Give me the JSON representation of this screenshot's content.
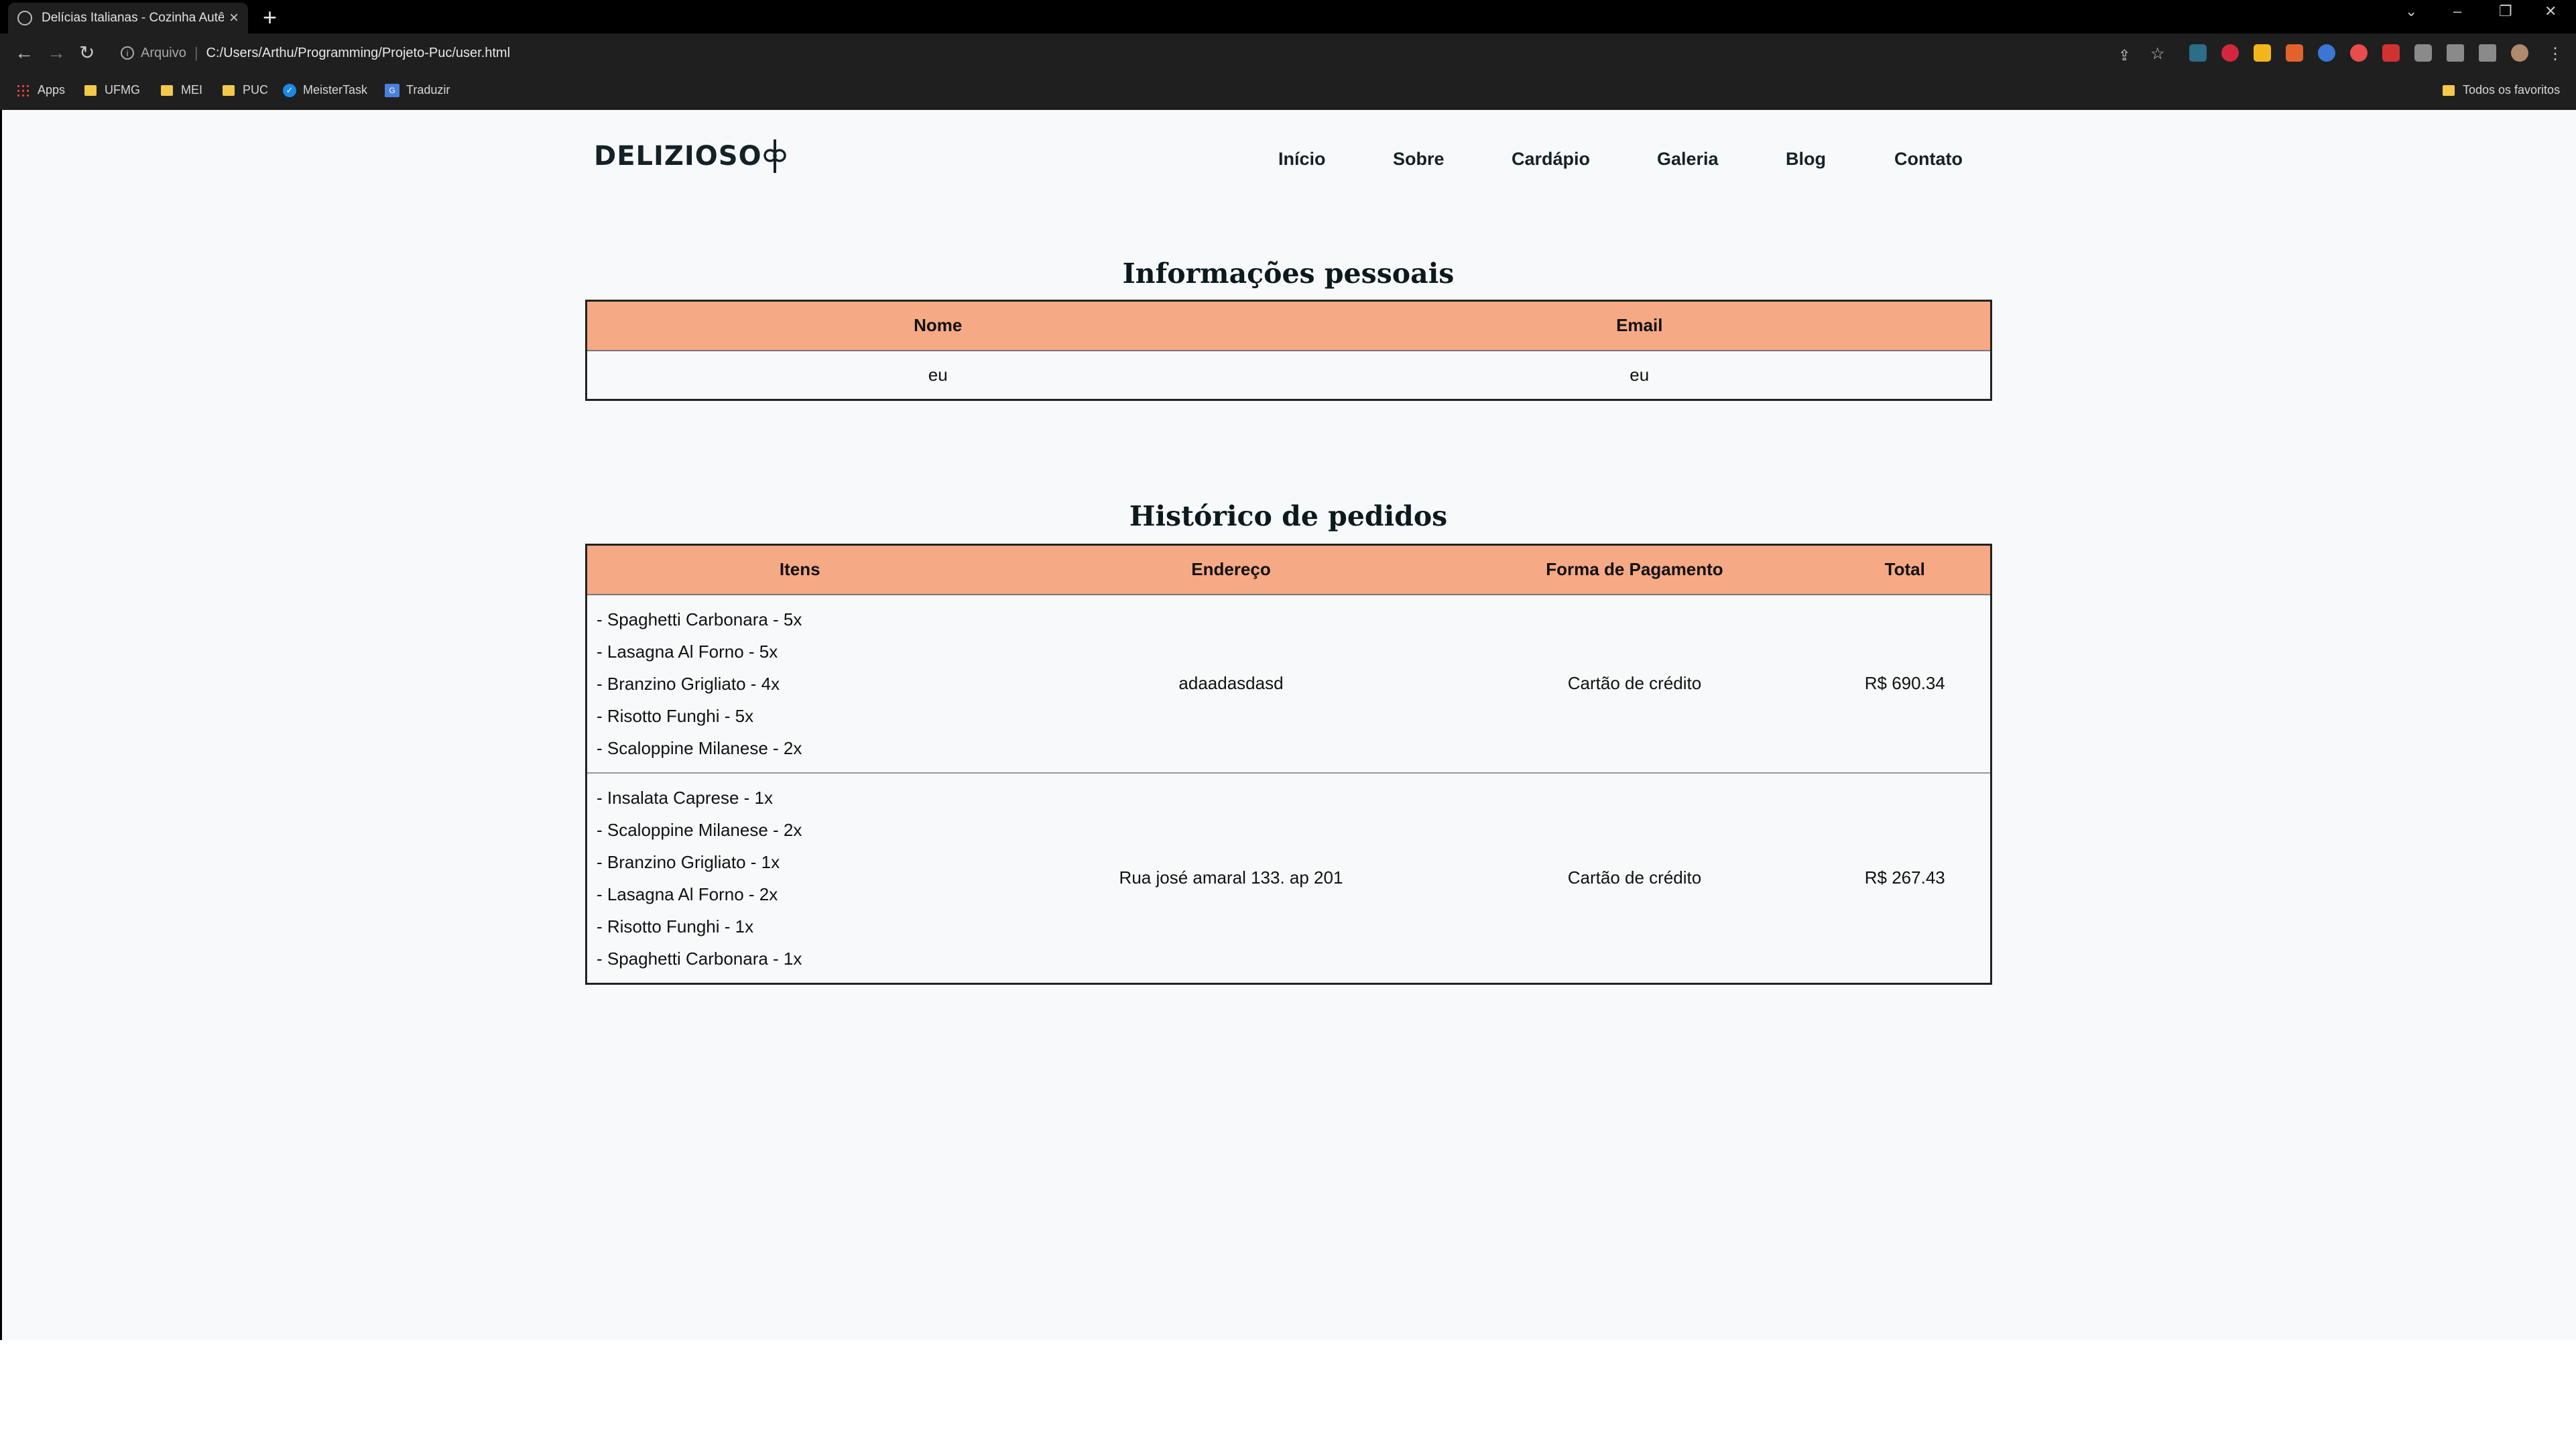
{
  "browser": {
    "tab_title": "Delícias Italianas - Cozinha Autê",
    "omnibox_label": "Arquivo",
    "url": "C:/Users/Arthu/Programming/Projeto-Puc/user.html",
    "bookmarks": [
      "Apps",
      "UFMG",
      "MEI",
      "PUC",
      "MeisterTask",
      "Traduzir"
    ],
    "all_bookmarks": "Todos os favoritos"
  },
  "site": {
    "logo": "DELIZIOSO",
    "nav": [
      "Início",
      "Sobre",
      "Cardápio",
      "Galeria",
      "Blog",
      "Contato"
    ]
  },
  "personal_info": {
    "title": "Informações pessoais",
    "headers": [
      "Nome",
      "Email"
    ],
    "values": [
      "eu",
      "eu"
    ]
  },
  "orders": {
    "title": "Histórico de pedidos",
    "headers": [
      "Itens",
      "Endereço",
      "Forma de Pagamento",
      "Total"
    ],
    "rows": [
      {
        "items": [
          "- Spaghetti Carbonara - 5x",
          "- Lasagna Al Forno - 5x",
          "- Branzino Grigliato - 4x",
          "- Risotto Funghi - 5x",
          "- Scaloppine Milanese - 2x"
        ],
        "address": "adaadasdasd",
        "payment": "Cartão de crédito",
        "total": "R$ 690.34"
      },
      {
        "items": [
          "- Insalata Caprese - 1x",
          "- Scaloppine Milanese - 2x",
          "- Branzino Grigliato - 1x",
          "- Lasagna Al Forno - 2x",
          "- Risotto Funghi - 1x",
          "- Spaghetti Carbonara - 1x"
        ],
        "address": "Rua josé amaral 133. ap 201",
        "payment": "Cartão de crédito",
        "total": "R$ 267.43"
      }
    ]
  }
}
